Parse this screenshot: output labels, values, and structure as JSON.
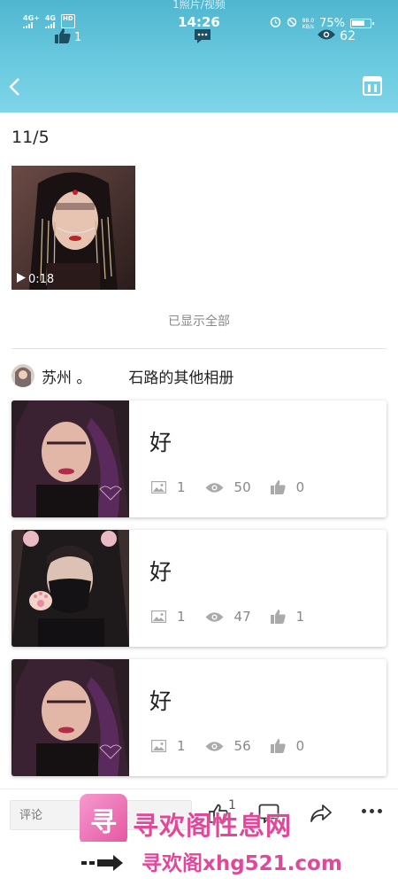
{
  "header": {
    "caption": "1照片/视频",
    "time": "14:26",
    "battery": "75%",
    "network": {
      "sim1": "4G+",
      "sim2": "4G",
      "hd": "HD",
      "speed_value": "88.0",
      "speed_unit": "KB/s"
    },
    "like_count": "1",
    "view_count": "62"
  },
  "date_title": "11/5",
  "video": {
    "duration": "0:18"
  },
  "shown_all_text": "已显示全部",
  "owner": {
    "name": "苏州 。",
    "other_albums_label": "石路的其他相册"
  },
  "albums": [
    {
      "title": "好",
      "photos": "1",
      "views": "50",
      "likes": "0"
    },
    {
      "title": "好",
      "photos": "1",
      "views": "47",
      "likes": "1"
    },
    {
      "title": "好",
      "photos": "1",
      "views": "56",
      "likes": "0"
    }
  ],
  "bottom_bar": {
    "comment_placeholder": "评论",
    "like_count": "1"
  },
  "watermark": {
    "logo_text": "寻",
    "cn_text": "寻欢阁性息网",
    "url_text": "寻欢阁xhg521.com"
  },
  "colors": {
    "header_top": "#4fb6cf",
    "header_bottom": "#7fd4e8",
    "watermark_pink": "#e2489a"
  }
}
